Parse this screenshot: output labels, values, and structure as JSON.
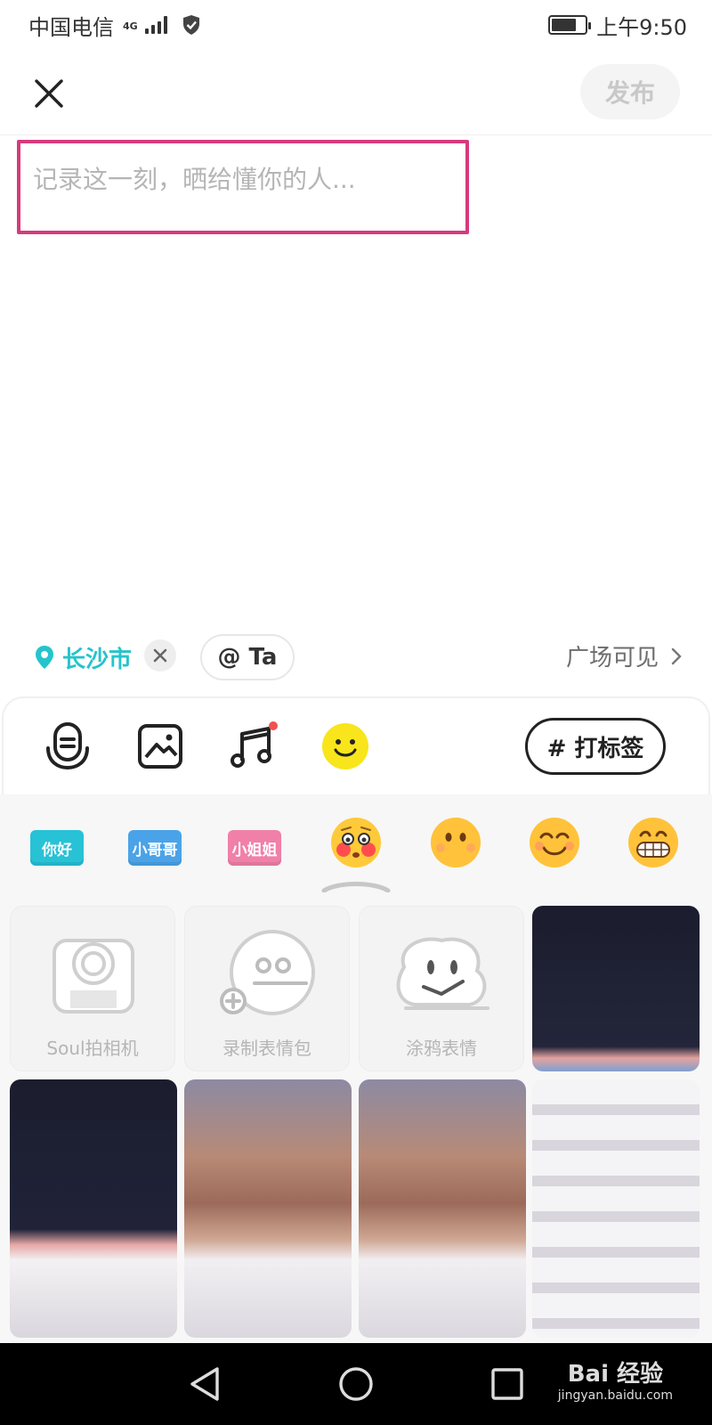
{
  "status_bar": {
    "carrier": "中国电信",
    "network": "4G",
    "time": "上午9:50",
    "battery_level": 0.75
  },
  "header": {
    "close_icon": "close-icon",
    "publish_label": "发布"
  },
  "compose": {
    "placeholder": "记录这一刻，晒给懂你的人...",
    "value": ""
  },
  "meta": {
    "location": "长沙市",
    "mention_label": "@ Ta",
    "visibility_label": "广场可见"
  },
  "toolbar": {
    "tools": [
      "voice-icon",
      "image-icon",
      "music-icon",
      "emoji-icon"
    ],
    "tag_label": "# 打标签"
  },
  "stickers": {
    "text_stickers": [
      "你好",
      "小哥哥",
      "小姐姐"
    ],
    "emojis": [
      "blushing-face",
      "neutral-face",
      "smiling-face",
      "grinning-face"
    ],
    "tools": [
      {
        "label": "Soul拍相机",
        "icon": "camera-icon"
      },
      {
        "label": "录制表情包",
        "icon": "record-face-icon"
      },
      {
        "label": "涂鸦表情",
        "icon": "doodle-icon"
      }
    ]
  },
  "watermark": {
    "main": "Bai 经验",
    "sub": "jingyan.baidu.com"
  },
  "colors": {
    "accent_teal": "#25c4cc",
    "highlight_box": "#d63a7d",
    "sticker_teal": "#28c2d6",
    "sticker_blue": "#4aa3e8",
    "sticker_pink": "#f080a8"
  }
}
